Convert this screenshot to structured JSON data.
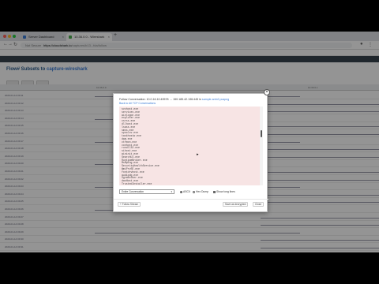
{
  "browser": {
    "tabs": [
      {
        "title": "Server Dashboard",
        "active": false
      },
      {
        "title": "10.36.0.0 - Wireshark",
        "active": true
      }
    ],
    "address": {
      "security": "Not Secure",
      "host": "https://cloudshark.io",
      "path": "/captures/b13...fda/follow"
    }
  },
  "page": {
    "crumb_prefix": "Flow# Subsets to",
    "crumb_link": "capture-wireshark",
    "grid_headers": [
      "",
      "10.36.0.0",
      "",
      "",
      "10.36.0.1"
    ],
    "row_labels": [
      "2020-01-14 09:11",
      "2020-01-14 09:12",
      "2020-01-14 09:13",
      "2020-01-14 09:14",
      "2020-01-14 09:15",
      "2020-01-14 09:16",
      "2020-01-14 09:17",
      "2020-01-14 09:18",
      "2020-01-14 09:19",
      "2020-01-14 09:20",
      "2020-01-14 09:21",
      "2020-01-14 09:22",
      "2020-01-14 09:23",
      "2020-01-14 09:24",
      "2020-01-14 09:25",
      "2020-01-14 09:26",
      "2020-01-14 09:27",
      "2020-01-14 09:28",
      "2020-01-14 09:29",
      "2020-01-14 09:30",
      "2020-01-14 09:31"
    ]
  },
  "modal": {
    "title_prefix": "Follow Conversation: 10.0.16.10:49578 → 150.185.42.136:445 in",
    "title_link": "sample-smb2.pcapng",
    "subtitle": "Back to All TCP Conversations",
    "stream_lines": [
      "svchost.exe",
      "services.exe",
      "winlogon.exe",
      "explorer.exe",
      "csrss.exe",
      "dllhost.exe",
      "lsass.exe",
      "smss.exe",
      "spoolsv.exe",
      "taskhostw.exe",
      "dwm.exe",
      "ctfmon.exe",
      "conhost.exe",
      "rundll32.exe",
      "sihost.exe",
      "wininit.exe",
      "SearchUI.exe",
      "RuntimeBroker.exe",
      "MsMpEng.exe",
      "SecurityHealthService.exe",
      "WmiPrvSE.exe",
      "fontdrvhost.exe",
      "audiodg.exe",
      "SgrmBroker.exe",
      "dasHost.exe",
      "TrustedInstaller.exe",
      "SearchIndexer.exe",
      "ShellExperienceHost.exe",
      "backgroundTaskHost.exe",
      "smartscreen.exe",
      "WUDFHost.exe",
      "MpCmdRun.exe",
      "SystemSettings.exe"
    ],
    "conversation_select": "Entire Conversation",
    "options": {
      "ascii": "ASCII",
      "hex_dump": "Hex Dump",
      "wrap": "Show long lines"
    },
    "footer": {
      "left": "+ Follow Stream",
      "save": "Save as decrypted",
      "close": "Close"
    }
  }
}
